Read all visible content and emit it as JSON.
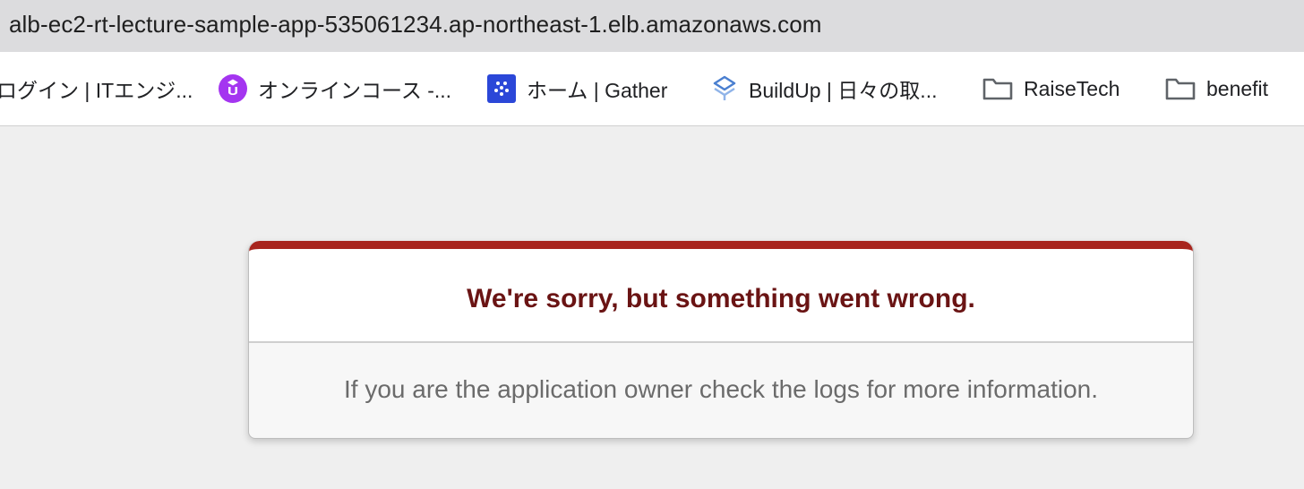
{
  "browser": {
    "url": "alb-ec2-rt-lecture-sample-app-535061234.ap-northeast-1.elb.amazonaws.com"
  },
  "bookmarks": [
    {
      "label": "ログイン | ITエンジ...",
      "icon": "none"
    },
    {
      "label": "オンラインコース -...",
      "icon": "udemy-icon"
    },
    {
      "label": "ホーム | Gather",
      "icon": "gather-icon"
    },
    {
      "label": "BuildUp | 日々の取...",
      "icon": "buildup-icon"
    },
    {
      "label": "RaiseTech",
      "icon": "folder-icon"
    },
    {
      "label": "benefit",
      "icon": "folder-icon"
    }
  ],
  "error": {
    "title": "We're sorry, but something went wrong.",
    "message": "If you are the application owner check the logs for more information.",
    "accent_color": "#A8251E",
    "title_color": "#6A1414"
  }
}
